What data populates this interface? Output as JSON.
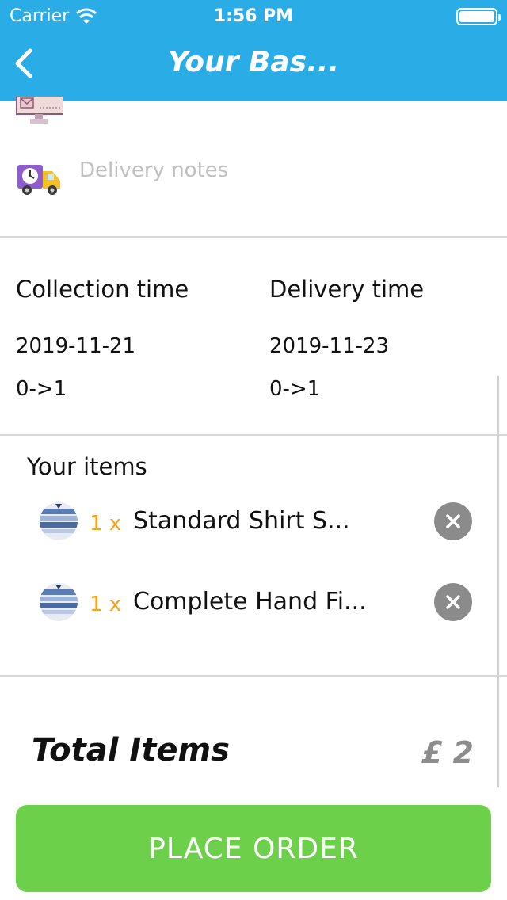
{
  "status_bar": {
    "carrier": "Carrier",
    "time": "1:56 PM",
    "battery_level": 1.0
  },
  "nav": {
    "title": "Your Bas...",
    "back_icon": "chevron-left-icon"
  },
  "delivery": {
    "notes_placeholder": "Delivery notes",
    "notes_icon": "delivery-truck-clock-icon",
    "address_icon": "billboard-icon"
  },
  "times": {
    "collection_label": "Collection time",
    "delivery_label": "Delivery time",
    "collection_date": "2019-11-21",
    "delivery_date": "2019-11-23",
    "collection_slot": "0->1",
    "delivery_slot": "0->1"
  },
  "items": {
    "label": "Your items",
    "list": [
      {
        "qty": "1 x",
        "name": "Standard Shirt S..."
      },
      {
        "qty": "1 x",
        "name": "Complete Hand Fi..."
      }
    ]
  },
  "total": {
    "label": "Total Items",
    "price": "£ 2"
  },
  "actions": {
    "place_order": "PLACE ORDER"
  },
  "colors": {
    "header": "#2aace6",
    "qty": "#f4a11c",
    "place_order": "#6dd04b",
    "remove": "#8b8b8b"
  }
}
